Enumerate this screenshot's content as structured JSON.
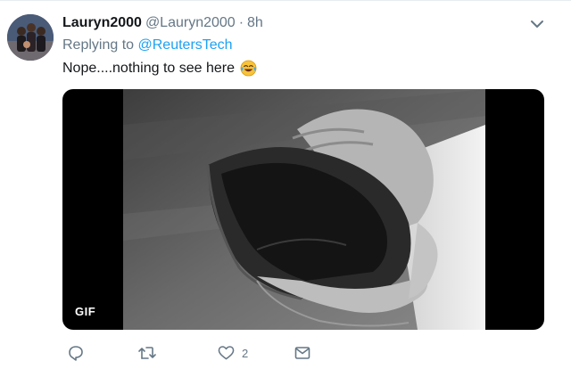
{
  "tweet": {
    "display_name": "Lauryn2000",
    "handle": "@Lauryn2000",
    "separator": "·",
    "time": "8h",
    "replying_prefix": "Replying to",
    "replying_to": "@ReutersTech",
    "text": "Nope....nothing to see here",
    "emoji": "face-with-tears-of-joy-icon",
    "media": {
      "badge": "GIF"
    },
    "actions": {
      "reply_count": "",
      "retweet_count": "",
      "like_count": "2",
      "message_count": ""
    }
  },
  "colors": {
    "link": "#1da1f2",
    "secondary_text": "#657786",
    "primary_text": "#14171a"
  }
}
